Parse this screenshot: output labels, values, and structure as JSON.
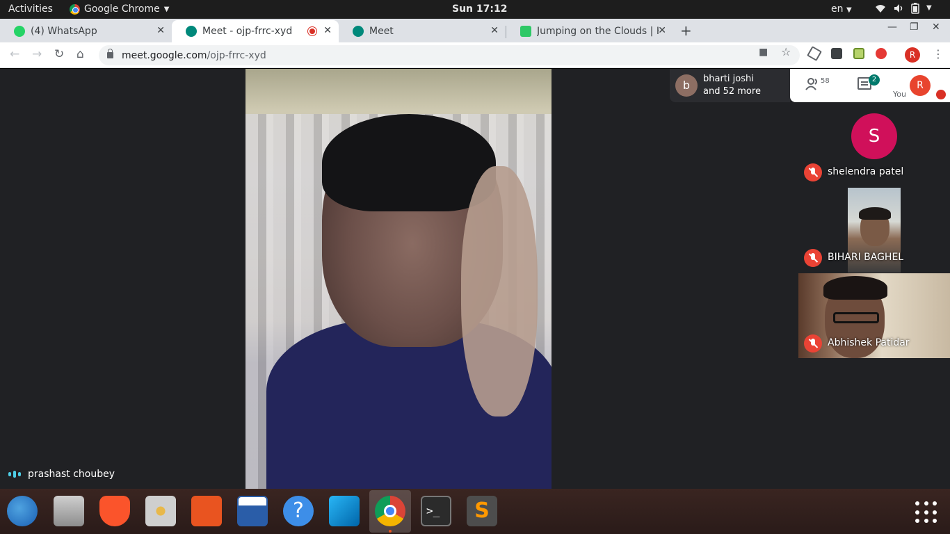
{
  "topbar": {
    "activities": "Activities",
    "app_name": "Google Chrome",
    "clock": "Sun 17:12",
    "lang": "en",
    "tray_icons": [
      "wifi-icon",
      "volume-icon",
      "battery-icon",
      "chevron-down-icon"
    ]
  },
  "tabs": [
    {
      "title": "(4) WhatsApp",
      "favicon": "whatsapp-icon",
      "color": "#25d366"
    },
    {
      "title": "Meet - ojp-frrc-xyd",
      "favicon": "meet-icon",
      "color": "#00897b",
      "recording": true
    },
    {
      "title": "Meet",
      "favicon": "meet-icon",
      "color": "#00897b"
    },
    {
      "title": "Jumping on the Clouds | H",
      "favicon": "hackerrank-icon",
      "color": "#2ec866"
    }
  ],
  "toolbar": {
    "url_host": "meet.google.com",
    "url_path": "/ojp-frrc-xyd",
    "profile_initial": "R"
  },
  "meet": {
    "active_speaker": "prashast choubey",
    "people_chip": {
      "initial": "b",
      "line1": "bharti joshi",
      "line2": "and 52 more"
    },
    "participant_count": "58",
    "chat_badge": "2",
    "self_label": "You",
    "self_initial": "R",
    "participants": [
      {
        "name": "shelendra patel",
        "initial": "S",
        "muted": true
      },
      {
        "name": "BIHARI BAGHEL",
        "muted": true
      },
      {
        "name": "Abhishek Patidar",
        "muted": true
      }
    ]
  },
  "dock": {
    "apps": [
      "thunderbird-icon",
      "files-icon",
      "brave-icon",
      "rhythmbox-icon",
      "software-center-icon",
      "libreoffice-writer-icon",
      "help-icon",
      "vscode-icon",
      "chrome-icon",
      "terminal-icon",
      "sublime-text-icon"
    ],
    "show_apps": "show-applications-icon"
  }
}
